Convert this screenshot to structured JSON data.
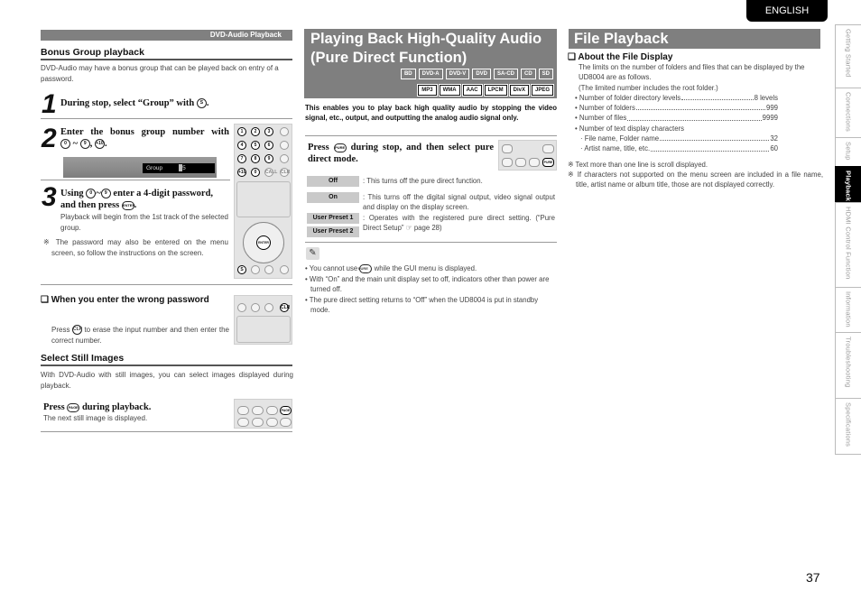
{
  "language_tab": "ENGLISH",
  "side_tabs": [
    {
      "label": "Getting Started",
      "active": false
    },
    {
      "label": "Connections",
      "active": false
    },
    {
      "label": "Setup",
      "active": false
    },
    {
      "label": "Playback",
      "active": true
    },
    {
      "label": "HDMI Control Function",
      "active": false
    },
    {
      "label": "Information",
      "active": false
    },
    {
      "label": "Troubleshooting",
      "active": false
    },
    {
      "label": "Specifications",
      "active": false
    }
  ],
  "page_number": "37",
  "left": {
    "section_bar": "DVD-Audio Playback",
    "bonus": {
      "heading": "Bonus Group playback",
      "intro": "DVD-Audio may have a bonus group that can be played back on entry of a password.",
      "step1": {
        "num": "1",
        "text": "During stop, select “Group” with",
        "button": "S",
        "button_caption": "SEARCH",
        "end": "."
      },
      "step2": {
        "num": "2",
        "text": "Enter the bonus group number with",
        "btn_from": "0",
        "tilde": "~",
        "btn_to": "9",
        "comma": ",",
        "btn_plus": "+10",
        "end": "."
      },
      "osd": {
        "label": "Group",
        "value": "5"
      },
      "step3": {
        "num": "3",
        "pre": "Using",
        "btn_from": "0",
        "tilde": "~",
        "btn_to": "9",
        "mid": "enter a 4-digit password,",
        "line2": "and then press",
        "button": "ENTER",
        "end": ".",
        "detail": "Playback will begin from the 1st track of the selected group."
      },
      "note": "※ The password may also be entered on the menu screen, so follow the instructions on the screen."
    },
    "wrong_password": {
      "heading": "❏ When you enter the wrong password",
      "pre": "Press",
      "button": "CLR",
      "button_caption": "CLEAR",
      "post": "to erase the input number and then enter the correct number."
    },
    "still": {
      "heading": "Select Still Images",
      "intro": "With DVD-Audio with still images, you can select images displayed during playback.",
      "step_pre": "Press",
      "button": "PAGE",
      "step_post": "during playback.",
      "detail": "The next still image is displayed."
    },
    "remote_keys": [
      "1",
      "2",
      "3",
      "4",
      "5",
      "6",
      "7",
      "8",
      "9",
      "+10",
      "0",
      "CALL",
      "CLR",
      "ENTER",
      "S"
    ]
  },
  "middle": {
    "title_line1": "Playing Back High-Quality Audio",
    "title_line2": "(Pure Direct Function)",
    "media_row1": [
      "BD",
      "DVD-A",
      "DVD-V",
      "DVD",
      "SA-CD",
      "CD",
      "SD"
    ],
    "media_row2": [
      "MP3",
      "WMA",
      "AAC",
      "LPCM",
      "DivX",
      "JPEG"
    ],
    "intro": "This enables you to play back high quality audio by stopping the video signal, etc., output, and outputting the analog audio signal only.",
    "step": {
      "pre": "Press",
      "button": "PURE",
      "button_caption": "PURE DIRECT",
      "post": "during stop, and then select pure direct mode."
    },
    "modes": [
      {
        "label": "Off",
        "desc": ": This turns off the pure direct function."
      },
      {
        "label": "On",
        "desc": ": This turns off the digital signal output, video signal output and display on the display screen."
      },
      {
        "label": "User Preset 1",
        "desc": ": Operates with the registered pure direct setting. (“Pure Direct Setup” ☞ page 28)"
      },
      {
        "label": "User Preset 2",
        "desc": ""
      }
    ],
    "notes_icon": "pencil-icon",
    "notes": [
      {
        "pre": "You cannot use",
        "button": "PURE",
        "post": "while the GUI menu is displayed."
      },
      {
        "pre": "With “On” and the main unit display set to off, indicators other than power are turned off.",
        "button": "",
        "post": ""
      },
      {
        "pre": "The pure direct setting returns to “Off” when the UD8004 is put in standby mode.",
        "button": "",
        "post": ""
      }
    ]
  },
  "right": {
    "title": "File Playback",
    "subheading": "❏ About the File Display",
    "intro1": "The limits on the number of folders and files that can be displayed by the UD8004 are as follows.",
    "intro2": "(The limited number includes the root folder.)",
    "limits": [
      {
        "label": "• Number of folder directory levels",
        "value": "8 levels"
      },
      {
        "label": "• Number of folders",
        "value": "999"
      },
      {
        "label": "• Number of files",
        "value": "9999"
      }
    ],
    "text_chars_label": "• Number of text display characters",
    "text_chars": [
      {
        "label": "· File name, Folder name",
        "value": "32"
      },
      {
        "label": "· Artist name, title, etc.",
        "value": "60"
      }
    ],
    "notes": [
      "※ Text more than one line is scroll displayed.",
      "※ If characters not supported on the menu screen are included in a file name, title, artist name or album title, those are not displayed correctly."
    ]
  }
}
